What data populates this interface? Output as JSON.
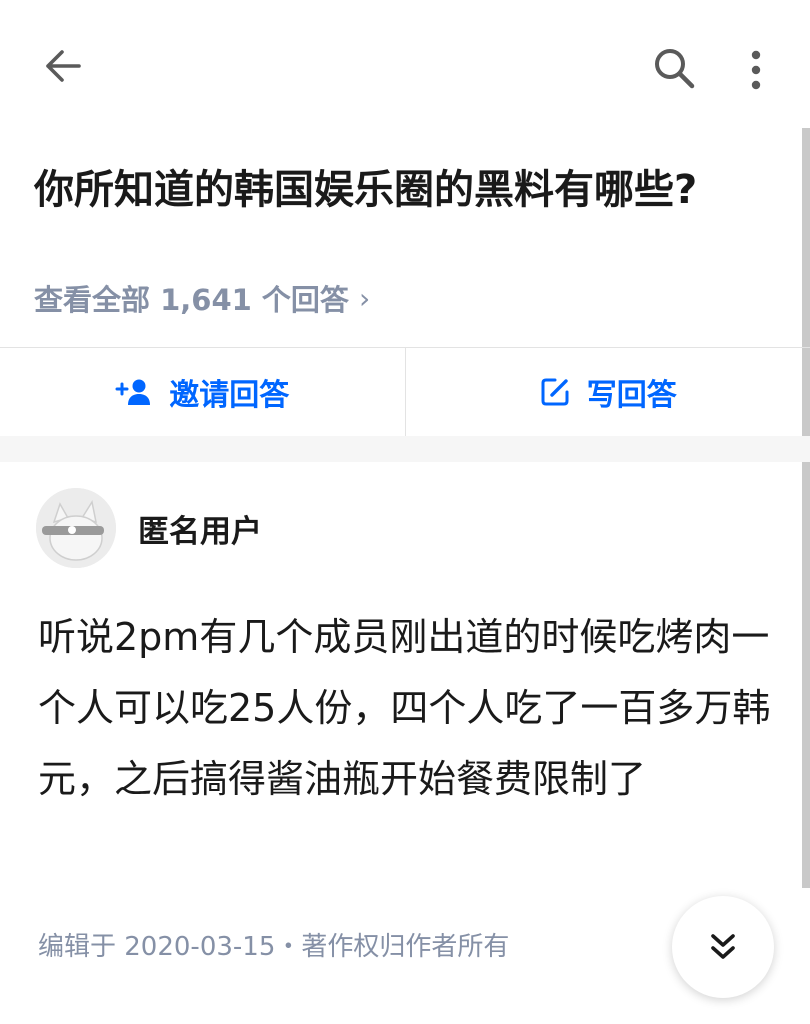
{
  "question": {
    "title": "你所知道的韩国娱乐圈的黑料有哪些?"
  },
  "answers_link": {
    "label": "查看全部 1,641 个回答",
    "chevron": "›"
  },
  "actions": {
    "invite_label": "邀请回答",
    "write_label": "写回答",
    "accent_color": "#0066ff"
  },
  "answer": {
    "author_name": "匿名用户",
    "body": "听说2pm有几个成员刚出道的时候吃烤肉一个人可以吃25人份，四个人吃了一百多万韩元，之后搞得酱油瓶开始餐费限制了",
    "meta": "编辑于 2020-03-15・著作权归作者所有"
  },
  "icons": {
    "back": "arrow-left-icon",
    "search": "search-icon",
    "more": "more-vertical-icon",
    "invite": "add-user-icon",
    "write": "edit-icon",
    "expand": "double-chevron-down-icon"
  }
}
